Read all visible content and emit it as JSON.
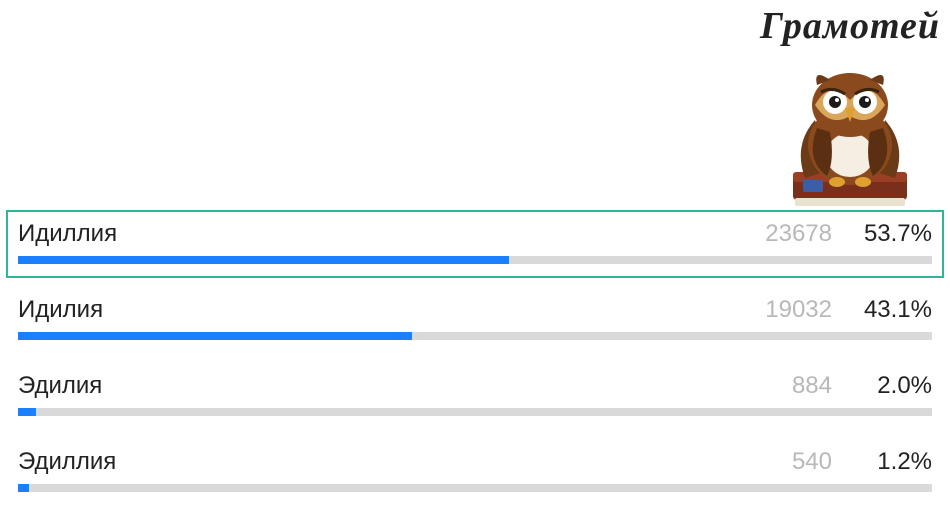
{
  "header": {
    "brand": "Грамотей"
  },
  "chart_data": {
    "type": "bar",
    "title": "",
    "xlabel": "",
    "ylabel": "",
    "categories": [
      "Идиллия",
      "Идилия",
      "Эдилия",
      "Эдиллия"
    ],
    "series": [
      {
        "name": "votes",
        "values": [
          23678,
          19032,
          884,
          540
        ]
      },
      {
        "name": "percent",
        "values": [
          53.7,
          43.1,
          2.0,
          1.2
        ]
      }
    ],
    "correct_index": 0
  },
  "results": [
    {
      "label": "Идиллия",
      "count": "23678",
      "percent": "53.7%",
      "width": 53.7,
      "correct": true
    },
    {
      "label": "Идилия",
      "count": "19032",
      "percent": "43.1%",
      "width": 43.1,
      "correct": false
    },
    {
      "label": "Эдилия",
      "count": "884",
      "percent": "2.0%",
      "width": 2.0,
      "correct": false
    },
    {
      "label": "Эдиллия",
      "count": "540",
      "percent": "1.2%",
      "width": 1.2,
      "correct": false
    }
  ]
}
